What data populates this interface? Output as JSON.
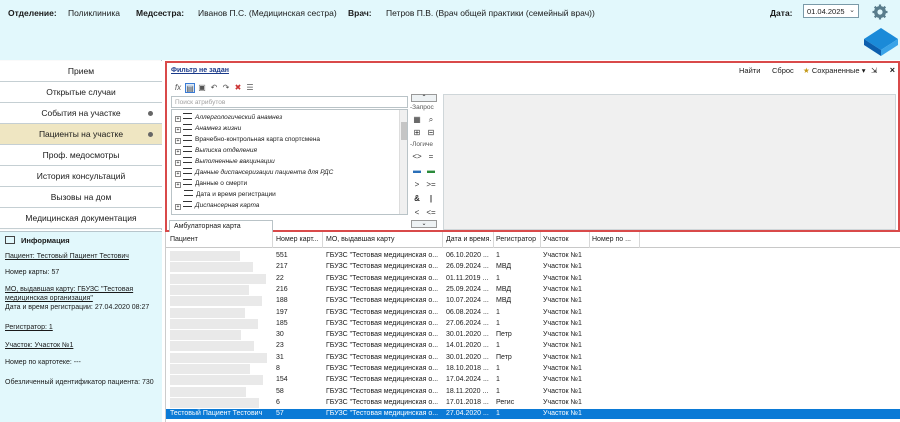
{
  "header": {
    "dept_label": "Отделение:",
    "dept_value": "Поликлиника",
    "nurse_label": "Медсестра:",
    "nurse_value": "Иванов П.С. (Медицинская сестра)",
    "doctor_label": "Врач:",
    "doctor_value": "Петров П.В. (Врач общей практики (семейный врач))",
    "date_label": "Дата:",
    "date_value": "01.04.2025"
  },
  "menu": {
    "items": [
      {
        "label": "Прием"
      },
      {
        "label": "Открытые случаи"
      },
      {
        "label": "События на участке"
      },
      {
        "label": "Пациенты на участке"
      },
      {
        "label": "Проф. медосмотры"
      },
      {
        "label": "История консультаций"
      },
      {
        "label": "Вызовы на дом"
      },
      {
        "label": "Медицинская документация"
      }
    ]
  },
  "info": {
    "title": "Информация",
    "patient": "Пациент: Тестовый Пациент Тестович",
    "card_number": "Номер карты: 57",
    "mo": "МО, выдавшая карту: ГБУЗС \"Тестовая медицинская организация\"",
    "reg_date": "Дата и время регистрации: 27.04.2020 08:27",
    "registrar": "Регистратор: 1",
    "area": "Участок: Участок №1",
    "file_number": "Номер по картотеке: ---",
    "depersonalized_id": "Обезличенный идентификатор пациента: 730"
  },
  "filter": {
    "status": "Фильтр не задан",
    "find": "Найти",
    "reset": "Сброс",
    "saved": "Сохраненные",
    "search_placeholder": "Поиск атрибутов",
    "tree": [
      "Аллергологический анамнез",
      "Анамнез жизни",
      "Врачебно-контрольная карта спортсмена",
      "Выписка отделения",
      "Выполненные вакцинации",
      "Данные диспансеризации пациента для РДС",
      "Данные о смерти",
      "Дата и время регистрации",
      "Диспансерная карта"
    ],
    "query_label": "-Запрос",
    "logic_label": "-Логиче",
    "tab": "Амбулаторная карта"
  },
  "grid": {
    "columns": [
      "Пациент",
      "Номер карт...",
      "МО, выдавшая карту",
      "Дата и время...",
      "Регистратор",
      "Участок",
      "Номер по ..."
    ],
    "rows": [
      {
        "patient": "",
        "card": "551",
        "mo": "ГБУЗС \"Тестовая медицинская о...",
        "date": "06.10.2020 ...",
        "reg": "1",
        "area": "Участок №1"
      },
      {
        "patient": "",
        "card": "217",
        "mo": "ГБУЗС \"Тестовая медицинская о...",
        "date": "26.09.2024 ...",
        "reg": "МВД",
        "area": "Участок №1"
      },
      {
        "patient": "",
        "card": "22",
        "mo": "ГБУЗС \"Тестовая медицинская о...",
        "date": "01.11.2019 ...",
        "reg": "1",
        "area": "Участок №1"
      },
      {
        "patient": "",
        "card": "216",
        "mo": "ГБУЗС \"Тестовая медицинская о...",
        "date": "25.09.2024 ...",
        "reg": "МВД",
        "area": "Участок №1"
      },
      {
        "patient": "",
        "card": "188",
        "mo": "ГБУЗС \"Тестовая медицинская о...",
        "date": "10.07.2024 ...",
        "reg": "МВД",
        "area": "Участок №1"
      },
      {
        "patient": "",
        "card": "197",
        "mo": "ГБУЗС \"Тестовая медицинская о...",
        "date": "06.08.2024 ...",
        "reg": "1",
        "area": "Участок №1"
      },
      {
        "patient": "",
        "card": "185",
        "mo": "ГБУЗС \"Тестовая медицинская о...",
        "date": "27.06.2024 ...",
        "reg": "1",
        "area": "Участок №1"
      },
      {
        "patient": "",
        "card": "30",
        "mo": "ГБУЗС \"Тестовая медицинская о...",
        "date": "30.01.2020 ...",
        "reg": "Петр",
        "area": "Участок №1"
      },
      {
        "patient": "",
        "card": "23",
        "mo": "ГБУЗС \"Тестовая медицинская о...",
        "date": "14.01.2020 ...",
        "reg": "1",
        "area": "Участок №1"
      },
      {
        "patient": "",
        "card": "31",
        "mo": "ГБУЗС \"Тестовая медицинская о...",
        "date": "30.01.2020 ...",
        "reg": "Петр",
        "area": "Участок №1"
      },
      {
        "patient": "",
        "card": "8",
        "mo": "ГБУЗС \"Тестовая медицинская о...",
        "date": "18.10.2018 ...",
        "reg": "1",
        "area": "Участок №1"
      },
      {
        "patient": "",
        "card": "154",
        "mo": "ГБУЗС \"Тестовая медицинская о...",
        "date": "17.04.2024 ...",
        "reg": "1",
        "area": "Участок №1"
      },
      {
        "patient": "",
        "card": "58",
        "mo": "ГБУЗС \"Тестовая медицинская о...",
        "date": "18.11.2020 ...",
        "reg": "1",
        "area": "Участок №1"
      },
      {
        "patient": "",
        "card": "6",
        "mo": "ГБУЗС \"Тестовая медицинская о...",
        "date": "17.01.2018 ...",
        "reg": "Регис",
        "area": "Участок №1"
      },
      {
        "patient": "Тестовый Пациент Тестович",
        "card": "57",
        "mo": "ГБУЗС \"Тестовая медицинская о...",
        "date": "27.04.2020 ...",
        "reg": "1",
        "area": "Участок №1"
      }
    ]
  },
  "colors": {
    "header_bg": "#e2f8fc",
    "active_menu": "#efe6c2",
    "filter_border": "#d94a4a",
    "selected_row": "#0b7ad6"
  }
}
